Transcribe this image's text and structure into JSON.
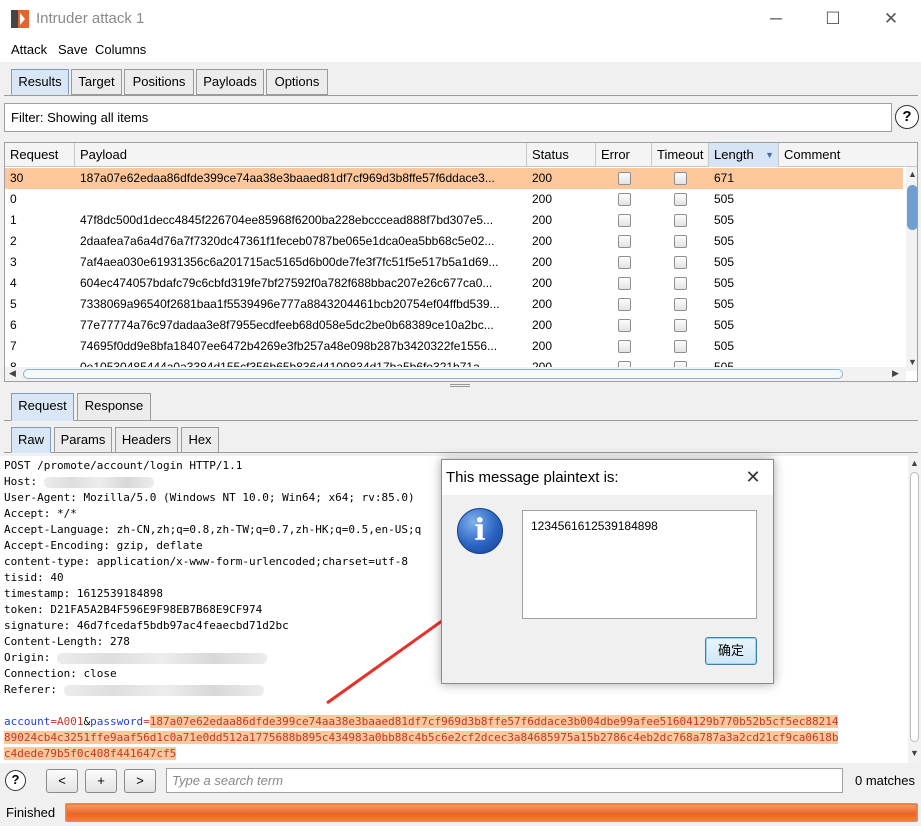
{
  "window": {
    "title": "Intruder attack 1",
    "minimize": "─",
    "maximize": "☐",
    "close": "✕"
  },
  "menu": [
    "Attack",
    "Save",
    "Columns"
  ],
  "main_tabs": [
    "Results",
    "Target",
    "Positions",
    "Payloads",
    "Options"
  ],
  "filter": {
    "text": "Filter: Showing all items",
    "help": "?"
  },
  "table": {
    "columns": [
      "Request",
      "Payload",
      "Status",
      "Error",
      "Timeout",
      "Length",
      "Comment"
    ],
    "sorted_column": "Length",
    "rows": [
      {
        "request": "30",
        "payload": "187a07e62edaa86dfde399ce74aa38e3baaed81df7cf969d3b8ffe57f6ddace3...",
        "status": "200",
        "length": "671",
        "highlighted": true
      },
      {
        "request": "0",
        "payload": "",
        "status": "200",
        "length": "505"
      },
      {
        "request": "1",
        "payload": "47f8dc500d1decc4845f226704ee85968f6200ba228ebcccead888f7bd307e5...",
        "status": "200",
        "length": "505"
      },
      {
        "request": "2",
        "payload": "2daafea7a6a4d76a7f7320dc47361f1feceb0787be065e1dca0ea5bb68c5e02...",
        "status": "200",
        "length": "505"
      },
      {
        "request": "3",
        "payload": "7af4aea030e61931356c6a201715ac5165d6b00de7fe3f7fc51f5e517b5a1d69...",
        "status": "200",
        "length": "505"
      },
      {
        "request": "4",
        "payload": "604ec474057bdafc79c6cbfd319fe7bf27592f0a782f688bbac207e26c677ca0...",
        "status": "200",
        "length": "505"
      },
      {
        "request": "5",
        "payload": "7338069a96540f2681baa1f5539496e777a8843204461bcb20754ef04ffbd539...",
        "status": "200",
        "length": "505"
      },
      {
        "request": "6",
        "payload": "77e77774a76c97dadaa3e8f7955ecdfeeb68d058e5dc2be0b68389ce10a2bc...",
        "status": "200",
        "length": "505"
      },
      {
        "request": "7",
        "payload": "74695f0dd9e8bfa18407ee6472b4269e3fb257a48e098b287b3420322fe1556...",
        "status": "200",
        "length": "505"
      },
      {
        "request": "8",
        "payload": "0e10530485444a0a3384d155cf356b65b836d4109834d17ba5b6fe321b71a...",
        "status": "200",
        "length": "505"
      }
    ]
  },
  "detail_tabs": [
    "Request",
    "Response"
  ],
  "view_tabs": [
    "Raw",
    "Params",
    "Headers",
    "Hex"
  ],
  "request_lines": [
    "POST /promote/account/login HTTP/1.1",
    "Host: ",
    "User-Agent: Mozilla/5.0 (Windows NT 10.0; Win64; x64; rv:85.0)",
    "Accept: */*",
    "Accept-Language: zh-CN,zh;q=0.8,zh-TW;q=0.7,zh-HK;q=0.5,en-US;q",
    "Accept-Encoding: gzip, deflate",
    "content-type: application/x-www-form-urlencoded;charset=utf-8",
    "tisid: 40",
    "timestamp: 1612539184898",
    "token: D21FA5A2B4F596E9F98EB7B68E9CF974",
    "signature: 46d7fcedaf5bdb97ac4feaecbd71d2bc",
    "Content-Length: 278",
    "Origin: ",
    "Connection: close",
    "Referer: "
  ],
  "body": {
    "param1": "account",
    "value1": "A001",
    "amp": "&",
    "param2": "password",
    "eq": "=",
    "payload_line1": "187a07e62edaa86dfde399ce74aa38e3baaed81df7cf969d3b8ffe57f6ddace3b004dbe99afee51604129b770b52b5cf5ec88214",
    "payload_line2": "89024cb4c3251ffe9aaf56d1c0a71e0dd512a1775688b895c434983a0bb88c4b5c6e2cf2dcec3a84685975a15b2786c4eb2dc768a787a3a2cd21cf9ca0618b",
    "payload_line3": "c4dede79b5f0c408f441647cf5"
  },
  "bottom": {
    "help": "?",
    "prev": "<",
    "add": "+",
    "next": ">",
    "search_placeholder": "Type a search term",
    "matches": "0 matches"
  },
  "status": {
    "text": "Finished",
    "progress": 1.0
  },
  "dialog": {
    "title": "This message plaintext is:",
    "close": "✕",
    "icon": "i",
    "message": "1234561612539184898",
    "ok": "确定"
  },
  "colors": {
    "highlight": "#fbc79b",
    "progress": "#f07c3a",
    "arrow": "#e8302a",
    "param": "#1f3fd6"
  }
}
